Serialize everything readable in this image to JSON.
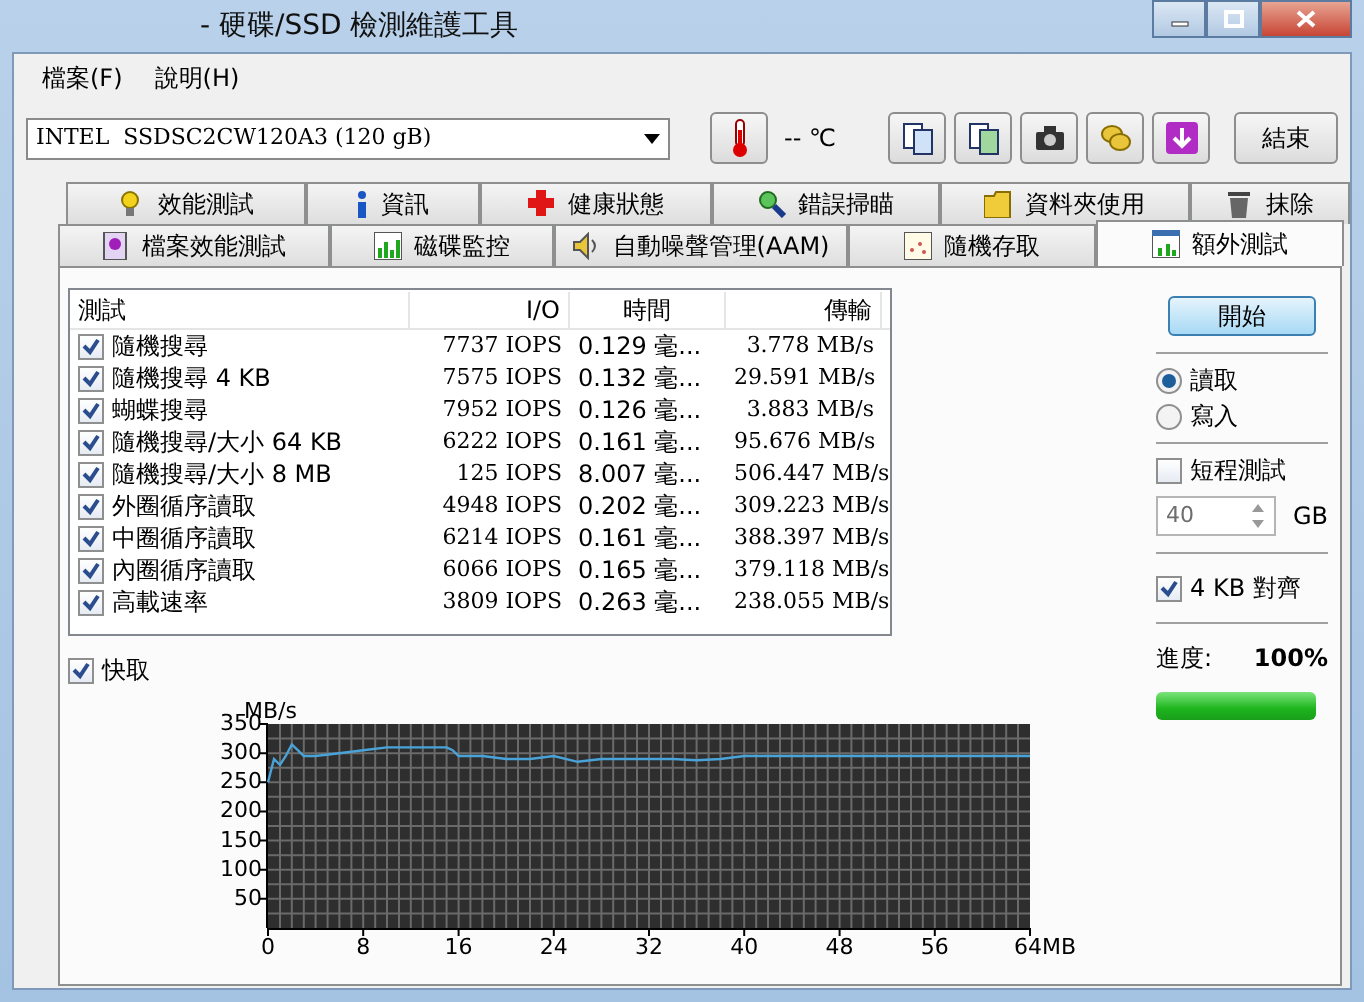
{
  "window": {
    "title": "- 硬碟/SSD 檢測維護工具"
  },
  "menu": [
    {
      "label": "檔案(F)"
    },
    {
      "label": "說明(H)"
    }
  ],
  "toolbar": {
    "drive": "INTEL  SSDSC2CW120A3 (120 gB)",
    "temperature": "-- ℃",
    "exit_button": "結束"
  },
  "tabs": [
    [
      {
        "label": "效能測試",
        "selected": false
      },
      {
        "label": "資訊",
        "selected": false
      },
      {
        "label": "健康狀態",
        "selected": false
      },
      {
        "label": "錯誤掃瞄",
        "selected": false
      },
      {
        "label": "資料夾使用",
        "selected": false
      },
      {
        "label": "抹除",
        "selected": false
      }
    ],
    [
      {
        "label": "檔案效能測試",
        "selected": false
      },
      {
        "label": "磁碟監控",
        "selected": false
      },
      {
        "label": "自動噪聲管理(AAM)",
        "selected": false
      },
      {
        "label": "隨機存取",
        "selected": false
      },
      {
        "label": "額外測試",
        "selected": true
      }
    ]
  ],
  "table": {
    "columns": [
      "測試",
      "I/O",
      "時間",
      "傳輸"
    ],
    "rows": [
      {
        "checked": true,
        "test": "隨機搜尋",
        "io": "7737 IOPS",
        "time": "0.129 毫...",
        "transfer": "3.778 MB/s"
      },
      {
        "checked": true,
        "test": "隨機搜尋 4 KB",
        "io": "7575 IOPS",
        "time": "0.132 毫...",
        "transfer": "29.591 MB/s"
      },
      {
        "checked": true,
        "test": "蝴蝶搜尋",
        "io": "7952 IOPS",
        "time": "0.126 毫...",
        "transfer": "3.883 MB/s"
      },
      {
        "checked": true,
        "test": "隨機搜尋/大小 64 KB",
        "io": "6222 IOPS",
        "time": "0.161 毫...",
        "transfer": "95.676 MB/s"
      },
      {
        "checked": true,
        "test": "隨機搜尋/大小 8 MB",
        "io": "125 IOPS",
        "time": "8.007 毫...",
        "transfer": "506.447 MB/s"
      },
      {
        "checked": true,
        "test": "外圈循序讀取",
        "io": "4948 IOPS",
        "time": "0.202 毫...",
        "transfer": "309.223 MB/s"
      },
      {
        "checked": true,
        "test": "中圈循序讀取",
        "io": "6214 IOPS",
        "time": "0.161 毫...",
        "transfer": "388.397 MB/s"
      },
      {
        "checked": true,
        "test": "內圈循序讀取",
        "io": "6066 IOPS",
        "time": "0.165 毫...",
        "transfer": "379.118 MB/s"
      },
      {
        "checked": true,
        "test": "高載速率",
        "io": "3809 IOPS",
        "time": "0.263 毫...",
        "transfer": "238.055 MB/s"
      }
    ]
  },
  "cache": {
    "label": "快取",
    "checked": true
  },
  "side": {
    "start_button": "開始",
    "modes": [
      {
        "label": "讀取",
        "selected": true
      },
      {
        "label": "寫入",
        "selected": false
      }
    ],
    "short_test": {
      "label": "短程測試",
      "checked": false
    },
    "size": {
      "value": "40",
      "unit": "GB"
    },
    "align": {
      "label": "4 KB 對齊",
      "checked": true
    },
    "progress_label": "進度:",
    "progress_value": "100%",
    "progress": {
      "level": 1
    }
  },
  "chart_data": {
    "type": "line",
    "grid": true,
    "ylabel": "MB/s",
    "xlim": [
      0,
      64
    ],
    "ylim": [
      0,
      350
    ],
    "xticks": [
      0,
      8,
      16,
      24,
      32,
      40,
      48,
      56,
      {
        "value": 64,
        "label": "64MB"
      }
    ],
    "yticks": [
      50,
      100,
      150,
      200,
      250,
      300,
      350
    ],
    "x": [
      0,
      0.5,
      1,
      1.5,
      2,
      2.5,
      3,
      4,
      6,
      8,
      10,
      12,
      14,
      15,
      15.5,
      16,
      18,
      20,
      22,
      24,
      26,
      28,
      30,
      32,
      34,
      36,
      38,
      40,
      42,
      44,
      46,
      48,
      50,
      52,
      54,
      56,
      58,
      60,
      62,
      64
    ],
    "series": [
      {
        "color": "#4aa3d8",
        "values": [
          250,
          290,
          280,
          295,
          315,
          305,
          295,
          295,
          300,
          305,
          310,
          310,
          310,
          310,
          305,
          295,
          295,
          290,
          290,
          295,
          285,
          290,
          290,
          290,
          290,
          288,
          290,
          295,
          295,
          295,
          295,
          295,
          295,
          295,
          295,
          295,
          295,
          295,
          295,
          295
        ]
      }
    ]
  }
}
